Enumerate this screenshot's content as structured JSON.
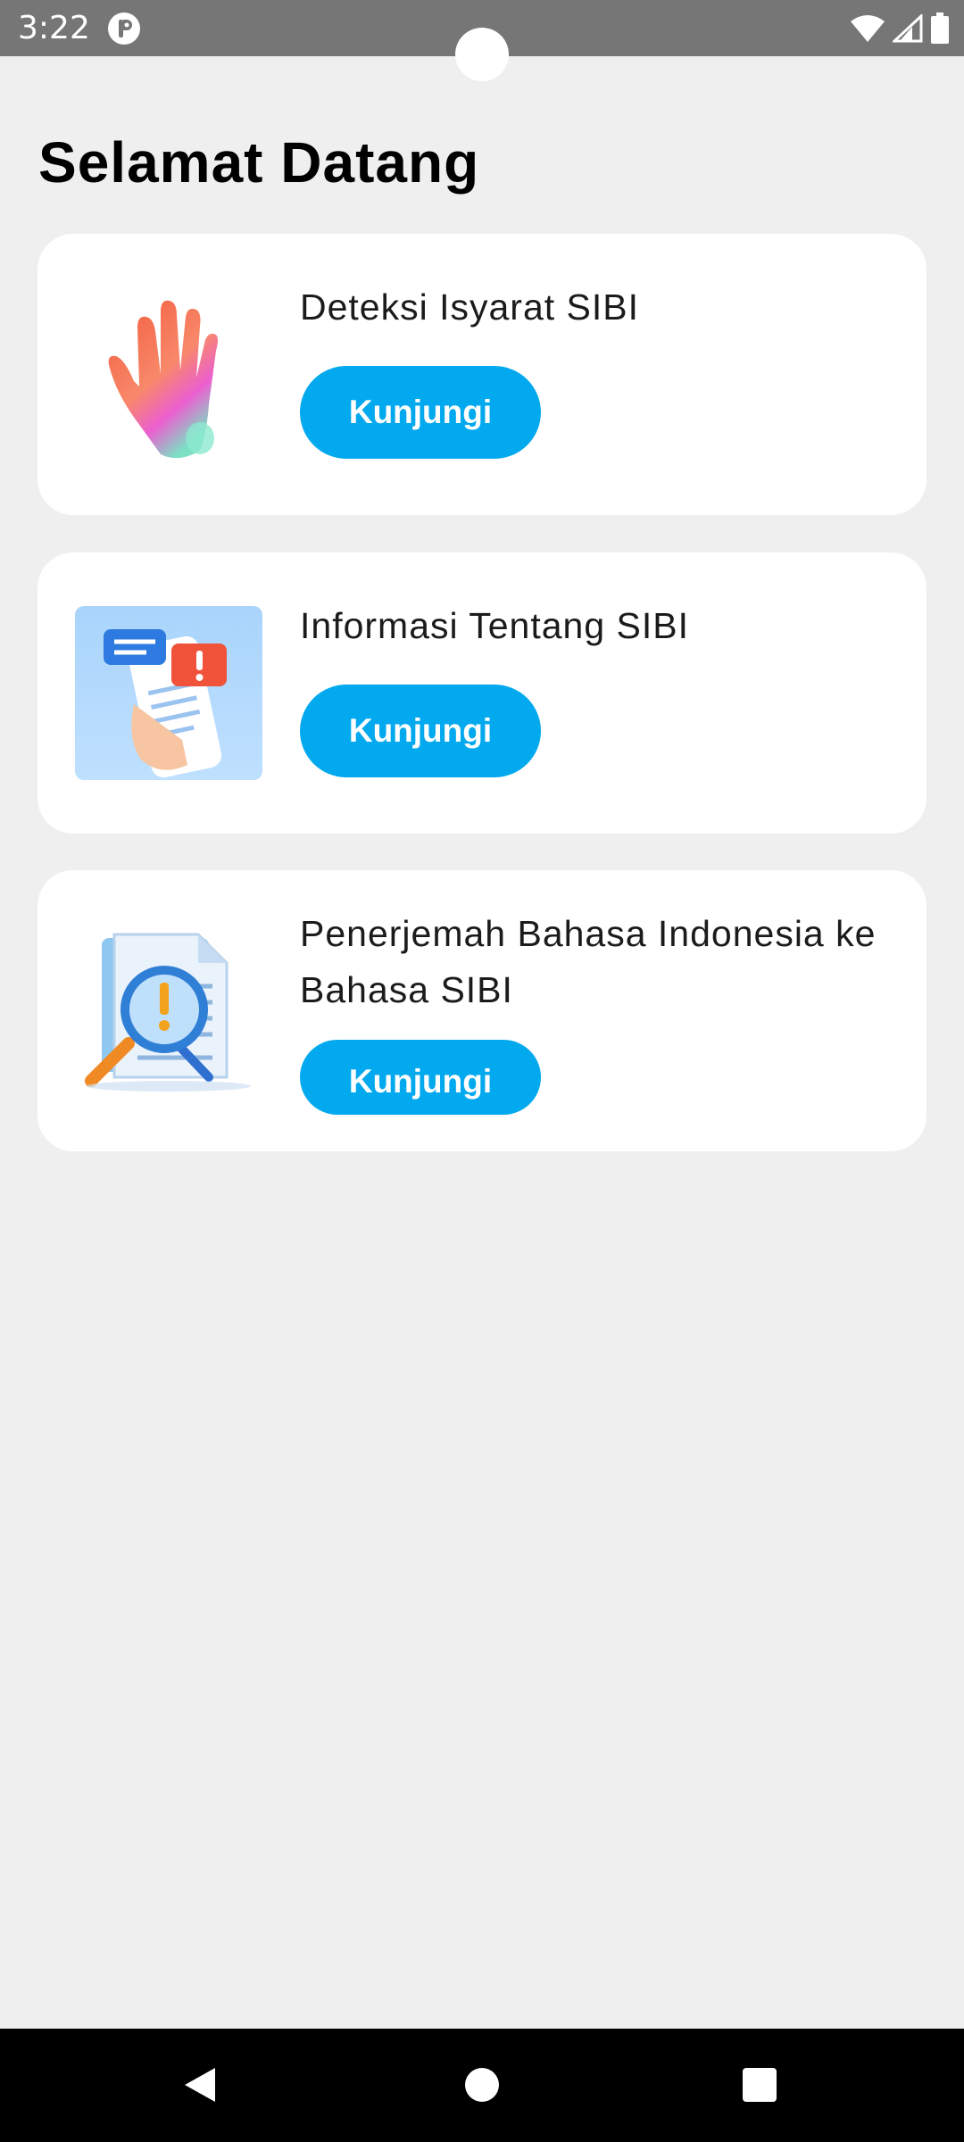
{
  "status_bar": {
    "time": "3:22"
  },
  "page": {
    "title": "Selamat Datang"
  },
  "cards": [
    {
      "title": "Deteksi Isyarat SIBI",
      "button_label": "Kunjungi",
      "image_icon": "waving-hand-icon"
    },
    {
      "title": "Informasi Tentang SIBI",
      "button_label": "Kunjungi",
      "image_icon": "phone-chat-icon"
    },
    {
      "title": "Penerjemah Bahasa Indonesia ke Bahasa SIBI",
      "button_label": "Kunjungi",
      "image_icon": "document-search-icon"
    }
  ],
  "colors": {
    "background": "#efefef",
    "card": "#ffffff",
    "button": "#03a9ee",
    "status_bar": "#767676",
    "nav_bar": "#000000"
  },
  "nav": {
    "icons": [
      "back-icon",
      "home-icon",
      "recents-icon"
    ]
  }
}
